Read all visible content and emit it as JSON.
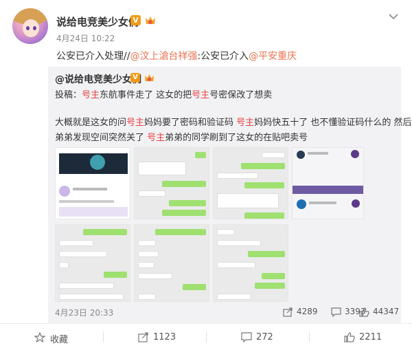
{
  "post": {
    "author": "说给电竞美少女们",
    "date": "4月24日 10:22",
    "text_prefix": "公安已介入处理//",
    "mention1": "@汶上滄台祥强",
    "text_mid": ":公安已介入",
    "mention2": "@平安重庆"
  },
  "repost": {
    "author": "@说给电竞美少女们",
    "line1": [
      "投稿：",
      "号主",
      "东航事件走了 这女的把",
      "号主",
      "号密保改了想卖"
    ],
    "line2": [
      "大概就是这女的问",
      "号主",
      "妈妈要了密码和验证码 ",
      "号主",
      "妈妈快五十了 也不懂验证码什么的 然后",
      "号主"
    ],
    "line3": [
      "弟弟发现空间突然关了 ",
      "号主",
      "弟弟的同学刷到了这女的在贴吧卖号"
    ],
    "date": "4月23日 20:33",
    "shares": "4289",
    "comments": "3393",
    "likes": "44347"
  },
  "actions": {
    "favorite": "收藏",
    "share": "1123",
    "comment": "272",
    "like": "2211"
  },
  "colors": {
    "link": "#eb7350",
    "highlight": "#eb4040",
    "badge": "#f29a17",
    "repost_bg": "#f2f2f5"
  }
}
